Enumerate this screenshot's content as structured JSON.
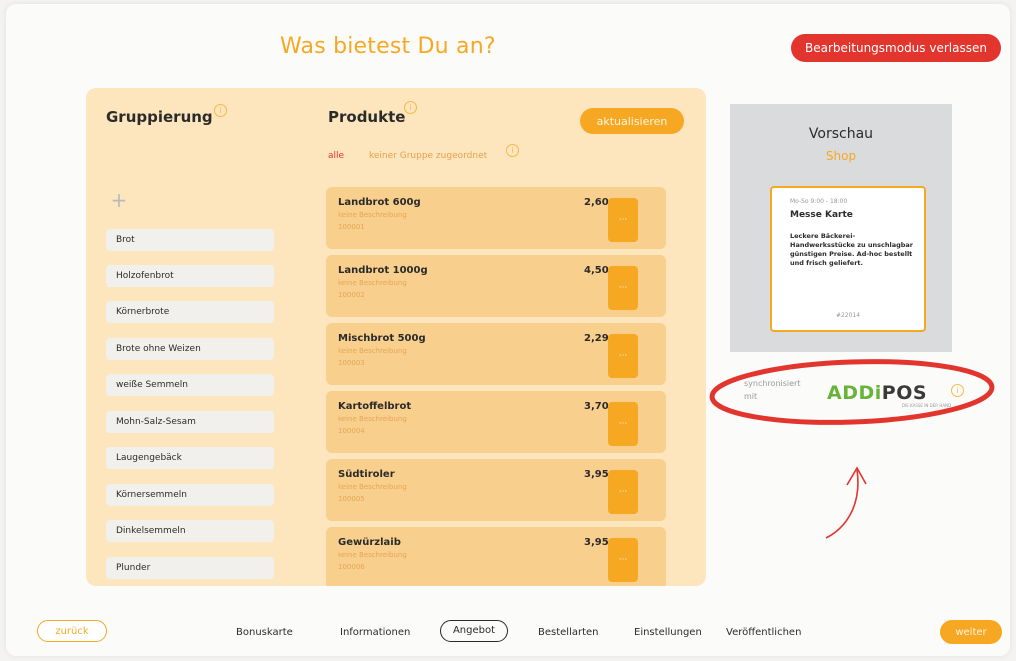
{
  "header": {
    "title": "Was bietest Du an?",
    "exit_edit_mode": "Bearbeitungsmodus verlassen"
  },
  "groups": {
    "heading": "Gruppierung",
    "add_symbol": "+",
    "items": [
      "Brot",
      "Holzofenbrot",
      "Körnerbrote",
      "Brote ohne Weizen",
      "weiße Semmeln",
      "Mohn-Salz-Sesam",
      "Laugengebäck",
      "Körnersemmeln",
      "Dinkelsemmeln",
      "Plunder"
    ]
  },
  "products": {
    "heading": "Produkte",
    "refresh_label": "aktualisieren",
    "filter_all": "alle",
    "filter_none": "keiner Gruppe zugeordnet",
    "button_label": "···",
    "items": [
      {
        "name": "Landbrot 600g",
        "desc": "keine Beschreibung",
        "id": "100001",
        "price": "2,60 €"
      },
      {
        "name": "Landbrot 1000g",
        "desc": "keine Beschreibung",
        "id": "100002",
        "price": "4,50 €"
      },
      {
        "name": "Mischbrot 500g",
        "desc": "keine Beschreibung",
        "id": "100003",
        "price": "2,29 €"
      },
      {
        "name": "Kartoffelbrot",
        "desc": "keine Beschreibung",
        "id": "100004",
        "price": "3,70 €"
      },
      {
        "name": "Südtiroler",
        "desc": "keine Beschreibung",
        "id": "100005",
        "price": "3,95 €"
      },
      {
        "name": "Gewürzlaib",
        "desc": "keine Beschreibung",
        "id": "100006",
        "price": "3,95 €"
      }
    ]
  },
  "preview": {
    "title": "Vorschau",
    "subtitle": "Shop",
    "card": {
      "hours": "Mo-So 9:00 - 18:00",
      "title": "Messe Karte",
      "description": "Leckere Bäckerei-Handwerksstücke zu unschlagbar günstigen Preise. Ad-hoc bestellt und frisch geliefert.",
      "number": "#22014"
    }
  },
  "sync": {
    "text_line1": "synchronisiert",
    "text_line2": "mit",
    "brand_add": "ADDi",
    "brand_pos": "POS",
    "brand_tagline": "DIE KASSE IN DER HAND"
  },
  "footer": {
    "back_label": "zurück",
    "next_label": "weiter",
    "nav": [
      "Bonuskarte",
      "Informationen",
      "Angebot",
      "Bestellarten",
      "Einstellungen",
      "Veröffentlichen"
    ],
    "active_index": 2
  },
  "colors": {
    "accent": "#f7a823",
    "danger": "#e2352d",
    "panel": "#fde5bd",
    "product_card": "#f8cf8c",
    "annotation_red": "#e2352d",
    "brand_green": "#67b43a"
  },
  "icons": [
    "info-icon",
    "plus-icon",
    "arrow-up-annotation"
  ]
}
